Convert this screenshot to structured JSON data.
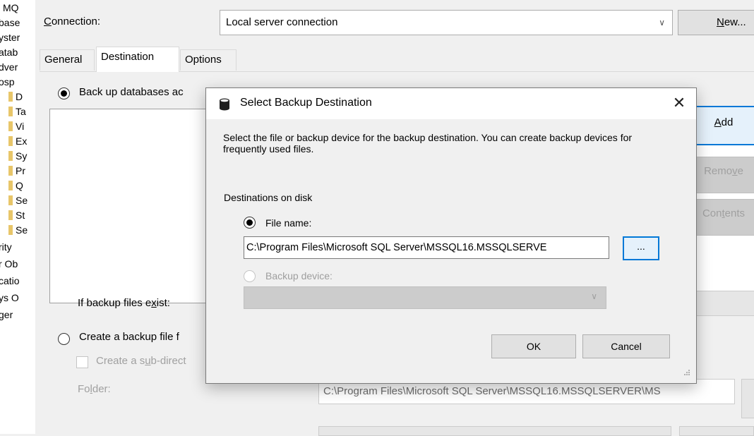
{
  "explorer": {
    "items": [
      "MQ",
      "base",
      "yster",
      "atab",
      "dver",
      "osp",
      "D",
      "Ta",
      "Vi",
      "Ex",
      "Sy",
      "Pr",
      "Q",
      "Se",
      "St",
      "Se",
      "rity",
      "r Ob",
      "catio",
      "ys O",
      "ger"
    ]
  },
  "connection": {
    "label_pre": "",
    "label_u": "C",
    "label_post": "onnection:",
    "value": "Local server connection",
    "new_u": "N",
    "new_post": "ew..."
  },
  "tabs": {
    "general": "General",
    "destination": "Destination",
    "options": "Options"
  },
  "destination": {
    "backup_radio_label": "Back up databases ac",
    "add_u": "A",
    "add_post": "dd",
    "remove_pre": "Remo",
    "remove_u": "v",
    "remove_post": "e",
    "contents_pre": "Con",
    "contents_u": "t",
    "contents_post": "ents",
    "exist_pre": "If backup files e",
    "exist_u": "x",
    "exist_post": "ist:",
    "create_radio_label": "Create a backup file f",
    "subdir_pre": "Create a s",
    "subdir_u": "u",
    "subdir_post": "b-direct",
    "folder_pre": "Fo",
    "folder_u": "l",
    "folder_post": "der:",
    "folder_value": "C:\\Program Files\\Microsoft SQL Server\\MSSQL16.MSSQLSERVER\\MS"
  },
  "dialog": {
    "title": "Select Backup Destination",
    "close": "✕",
    "description": "Select the file or backup device for the backup destination. You can create backup devices for frequently used files.",
    "destinations_label": "Destinations on disk",
    "file_name_label": "File name:",
    "file_name_value": "C:\\Program Files\\Microsoft SQL Server\\MSSQL16.MSSQLSERVE",
    "browse_label": "...",
    "backup_device_label": "Backup device:",
    "backup_device_value": "",
    "ok": "OK",
    "cancel": "Cancel"
  },
  "colors": {
    "focus_blue": "#0078d7",
    "dialog_bg": "#f0f0f0",
    "disabled_text": "#a0a0a0"
  },
  "icons": {
    "dialog": "database-icon",
    "dropdown": "chevron-down-icon",
    "close": "close-icon"
  }
}
